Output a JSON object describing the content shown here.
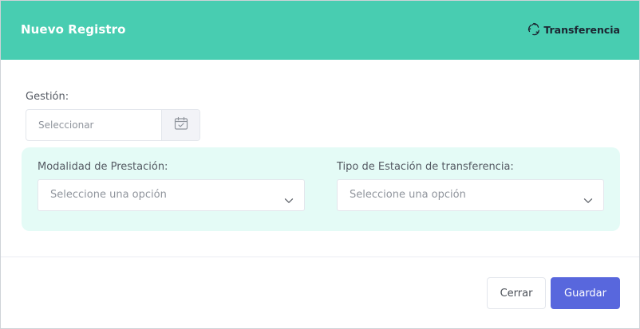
{
  "modal": {
    "title": "Nuevo Registro",
    "brand": {
      "icon": "recycle-icon",
      "label": "Transferencia"
    }
  },
  "form": {
    "gestion": {
      "label": "Gestión:",
      "placeholder": "Seleccionar",
      "icon": "calendar-check-icon"
    },
    "modalidad": {
      "label": "Modalidad de Prestación:",
      "selected": "Seleccione una opción"
    },
    "tipo_estacion": {
      "label": "Tipo de Estación de transferencia:",
      "selected": "Seleccione una opción"
    }
  },
  "footer": {
    "cerrar": "Cerrar",
    "guardar": "Guardar"
  },
  "colors": {
    "header": "#48cdb1",
    "panel": "#e4fbf6",
    "primary": "#5867dd"
  }
}
